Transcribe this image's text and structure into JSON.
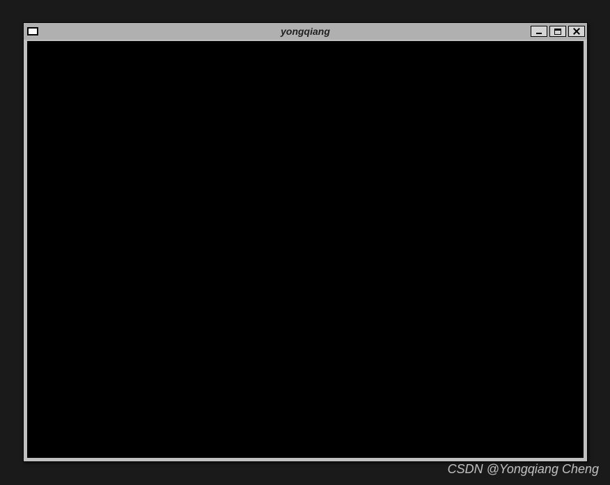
{
  "window": {
    "title": "yongqiang"
  },
  "watermark": {
    "text": "CSDN @Yongqiang Cheng"
  }
}
